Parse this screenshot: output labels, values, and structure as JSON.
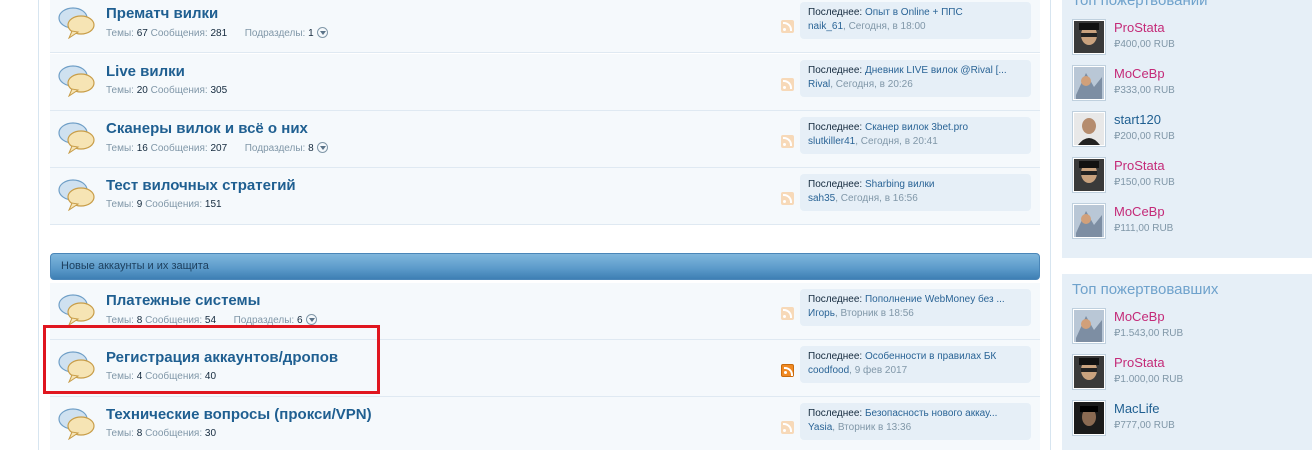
{
  "forums": [
    {
      "title": "Прематч вилки",
      "themes_label": "Темы:",
      "themes": "67",
      "messages_label": "Сообщения:",
      "messages": "281",
      "subforums_label": "Подразделы:",
      "subforums": "1",
      "last_label": "Последнее:",
      "last_title": "Опыт в Online + ППС",
      "last_user": "naik_61",
      "last_date": ", Сегодня, в 18:00"
    },
    {
      "title": "Live вилки",
      "themes_label": "Темы:",
      "themes": "20",
      "messages_label": "Сообщения:",
      "messages": "305",
      "last_label": "Последнее:",
      "last_title": "Дневник LIVE вилок @Rival [...",
      "last_user": "Rival",
      "last_date": ", Сегодня, в 20:26"
    },
    {
      "title": "Сканеры вилок и всё о них",
      "themes_label": "Темы:",
      "themes": "16",
      "messages_label": "Сообщения:",
      "messages": "207",
      "subforums_label": "Подразделы:",
      "subforums": "8",
      "last_label": "Последнее:",
      "last_title": "Сканер вилок 3bet.pro",
      "last_user": "slutkiller41",
      "last_date": ", Сегодня, в 20:41"
    },
    {
      "title": "Тест вилочных стратегий",
      "themes_label": "Темы:",
      "themes": "9",
      "messages_label": "Сообщения:",
      "messages": "151",
      "last_label": "Последнее:",
      "last_title": "Sharbing вилки",
      "last_user": "sah35",
      "last_date": ", Сегодня, в 16:56"
    },
    {
      "title": "Платежные системы",
      "themes_label": "Темы:",
      "themes": "8",
      "messages_label": "Сообщения:",
      "messages": "54",
      "subforums_label": "Подразделы:",
      "subforums": "6",
      "last_label": "Последнее:",
      "last_title": "Пополнение WebMoney без ...",
      "last_user": "Игорь",
      "last_date": ", Вторник в 18:56"
    },
    {
      "title": "Регистрация аккаунтов/дропов",
      "themes_label": "Темы:",
      "themes": "4",
      "messages_label": "Сообщения:",
      "messages": "40",
      "last_label": "Последнее:",
      "last_title": "Особенности в правилах БК",
      "last_user": "coodfood",
      "last_date": ", 9 фев 2017"
    },
    {
      "title": "Технические вопросы (прокси/VPN)",
      "themes_label": "Темы:",
      "themes": "8",
      "messages_label": "Сообщения:",
      "messages": "30",
      "last_label": "Последнее:",
      "last_title": "Безопасность нового аккау...",
      "last_user": "Yasia",
      "last_date": ", Вторник в 13:36"
    }
  ],
  "category": {
    "title": "Новые аккаунты и их защита"
  },
  "sidebar": {
    "top_donations": {
      "title": "Топ пожертвований",
      "items": [
        {
          "name": "ProStata",
          "amount": "₽400,00 RUB"
        },
        {
          "name": "MoCeBp",
          "amount": "₽333,00 RUB"
        },
        {
          "name": "start120",
          "amount": "₽200,00 RUB"
        },
        {
          "name": "ProStata",
          "amount": "₽150,00 RUB"
        },
        {
          "name": "MoCeBp",
          "amount": "₽111,00 RUB"
        }
      ]
    },
    "top_donors": {
      "title": "Топ пожертвовавших",
      "items": [
        {
          "name": "MoCeBp",
          "amount": "₽1.543,00 RUB"
        },
        {
          "name": "ProStata",
          "amount": "₽1.000,00 RUB"
        },
        {
          "name": "MacLife",
          "amount": "₽777,00 RUB"
        }
      ]
    }
  },
  "colors": {
    "accent": "#1f5f91",
    "highlight": "#e0161f",
    "rss": "#f08a24",
    "donor_pink": "#c42a78"
  },
  "icons": {
    "forum": "speech-bubbles-icon",
    "rss": "rss-icon",
    "toggle": "chevron-down-icon"
  }
}
